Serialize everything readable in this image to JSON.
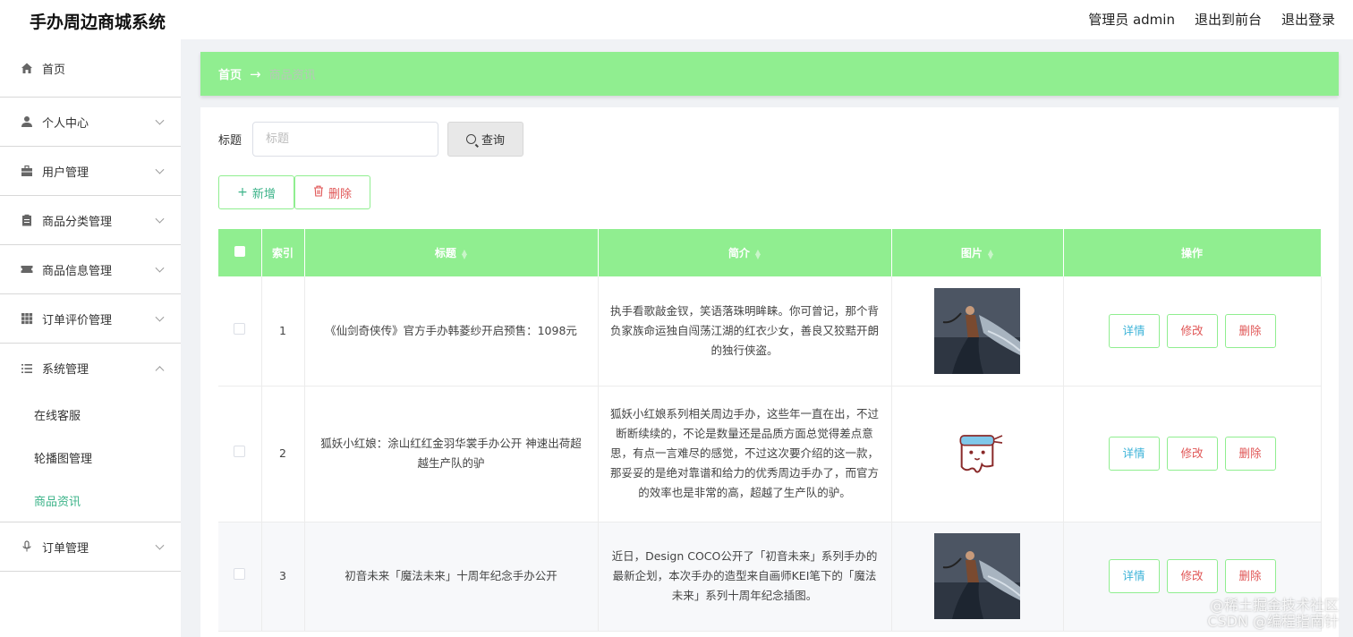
{
  "app_title": "手办周边商城系统",
  "header": {
    "admin_label": "管理员 admin",
    "to_front_label": "退出到前台",
    "logout_label": "退出登录"
  },
  "sidebar": {
    "items": [
      {
        "label": "首页",
        "icon": "home-icon"
      },
      {
        "label": "个人中心",
        "icon": "user-icon"
      },
      {
        "label": "用户管理",
        "icon": "briefcase-icon"
      },
      {
        "label": "商品分类管理",
        "icon": "clipboard-icon"
      },
      {
        "label": "商品信息管理",
        "icon": "ticket-icon"
      },
      {
        "label": "订单评价管理",
        "icon": "grid-icon"
      },
      {
        "label": "系统管理",
        "icon": "list-icon"
      },
      {
        "label": "订单管理",
        "icon": "microphone-icon"
      }
    ],
    "system_sub": [
      "在线客服",
      "轮播图管理",
      "商品资讯"
    ]
  },
  "breadcrumb": {
    "home": "首页",
    "arrow": "→",
    "current": "商品资讯"
  },
  "search": {
    "label": "标题",
    "placeholder": "标题",
    "value": "",
    "button": "查询"
  },
  "actions": {
    "add": "新增",
    "delete": "删除"
  },
  "table": {
    "headers": [
      "索引",
      "标题",
      "简介",
      "图片",
      "操作"
    ],
    "rows": [
      {
        "index": "1",
        "title": "《仙剑奇侠传》官方手办韩菱纱开启预售：1098元",
        "intro": "执手看歌敲金钗，笑语落珠明眸睐。你可曾记，那个背负家族命运独自闯荡江湖的红衣少女，善良又狡黠开朗的独行侠盗。",
        "image": "warrior-figure-image"
      },
      {
        "index": "2",
        "title": "狐妖小红娘：涂山红红金羽华裳手办公开 神速出荷超越生产队的驴",
        "intro": "狐妖小红娘系列相关周边手办，这些年一直在出，不过断断续续的，不论是数量还是品质方面总觉得差点意思，有点一言难尽的感觉，不过这次要介绍的这一款，那妥妥的是绝对靠谱和给力的优秀周边手办了，而官方的效率也是非常的高，超越了生产队的驴。",
        "image": "cartoon-mascot-image"
      },
      {
        "index": "3",
        "title": "初音未来「魔法未来」十周年纪念手办公开",
        "intro": "近日，Design COCO公开了「初音未来」系列手办的最新企划，本次手办的造型来自画师KEI笔下的「魔法未来」系列十周年纪念插图。",
        "image": "warrior-figure-image"
      }
    ],
    "row_actions": {
      "detail": "详情",
      "edit": "修改",
      "remove": "删除"
    }
  },
  "watermark": {
    "line1": "@稀土掘金技术社区",
    "line2": "CSDN @编程指南针"
  },
  "colors": {
    "accent_green": "#90ee90",
    "active_text": "#3cb389",
    "danger": "#e05656"
  }
}
